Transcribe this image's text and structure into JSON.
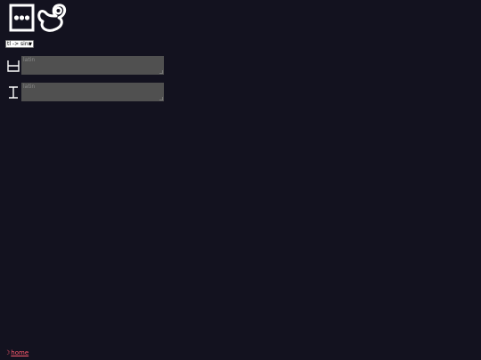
{
  "logo": {
    "icon": "sitelen-pona-logo"
  },
  "language_select": {
    "selected": "tl -> sina"
  },
  "fields": [
    {
      "glyph": "sitelen-pona-input-glyph",
      "placeholder": "latin"
    },
    {
      "glyph": "sitelen-pona-output-glyph",
      "placeholder": "latin"
    }
  ],
  "footer": {
    "home_icon": "moon-icon",
    "home_label": "home"
  },
  "colors": {
    "background": "#13121f",
    "field": "#505050",
    "link": "#ff5a6e"
  }
}
